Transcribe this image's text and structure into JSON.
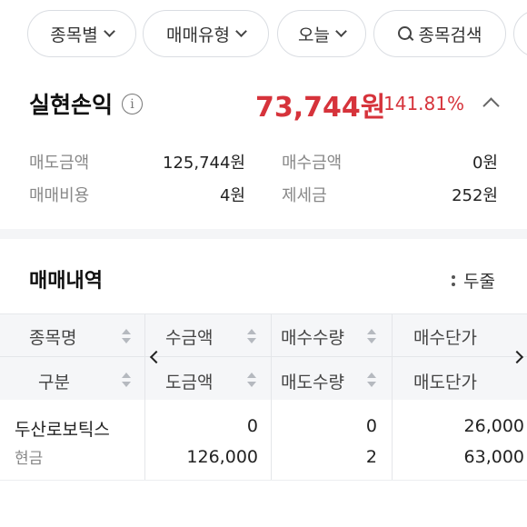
{
  "filters": {
    "by_stock": "종목별",
    "trade_type": "매매유형",
    "date": "오늘",
    "search": "종목검색"
  },
  "summary": {
    "title": "실현손익",
    "amount": "73,744원",
    "rate": "141.81%",
    "sell_amount_label": "매도금액",
    "sell_amount_value": "125,744원",
    "buy_amount_label": "매수금액",
    "buy_amount_value": "0원",
    "fee_label": "매매비용",
    "fee_value": "4원",
    "tax_label": "제세금",
    "tax_value": "252원"
  },
  "trades": {
    "title": "매매내역",
    "view_mode": "두줄",
    "columns_row1": [
      "종목명",
      "매수금액",
      "매수수량",
      "매수단가"
    ],
    "columns_row1_visible": [
      "종목명",
      "수금액",
      "매수수량",
      "매수단가"
    ],
    "columns_row2": [
      "구분",
      "매도금액",
      "매도수량",
      "매도단가"
    ],
    "columns_row2_visible": [
      "구분",
      "도금액",
      "매도수량",
      "매도단가"
    ],
    "rows": [
      {
        "stock_name": "두산로보틱스",
        "category": "현금",
        "buy_amount": "0",
        "buy_qty": "0",
        "buy_price": "26,000",
        "sell_amount": "126,000",
        "sell_qty": "2",
        "sell_price": "63,000"
      }
    ]
  },
  "colors": {
    "profit": "#d6333b",
    "header_bg": "#f5f6f8",
    "chip_border": "#dadde2"
  }
}
